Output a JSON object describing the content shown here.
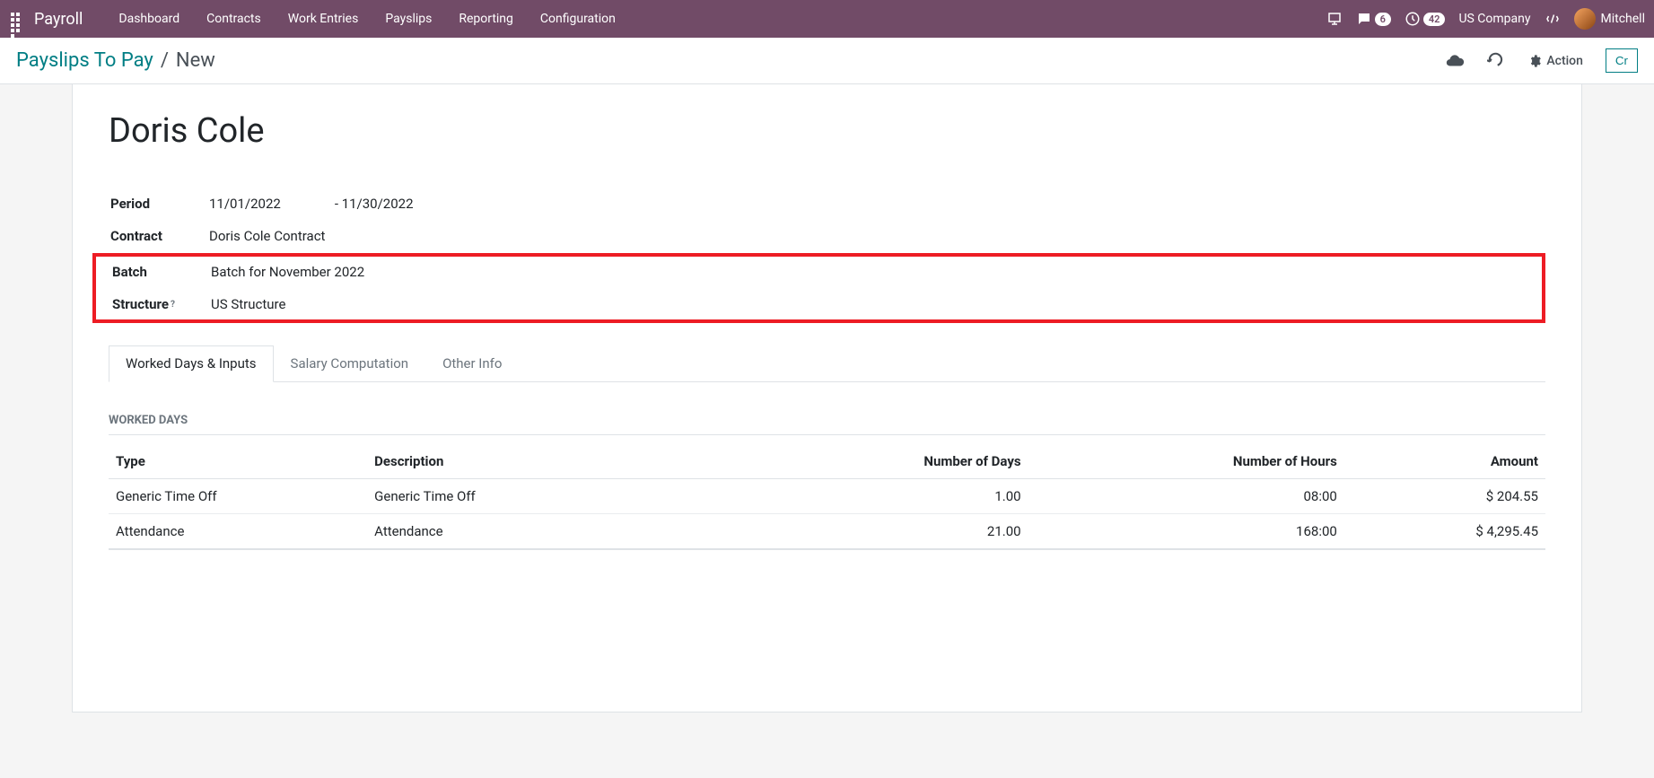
{
  "topbar": {
    "app_name": "Payroll",
    "nav": [
      "Dashboard",
      "Contracts",
      "Work Entries",
      "Payslips",
      "Reporting",
      "Configuration"
    ],
    "messages_count": "6",
    "activities_count": "42",
    "company": "US Company",
    "user": "Mitchell"
  },
  "breadcrumb": {
    "parent": "Payslips To Pay",
    "current": "New",
    "action_label": "Action",
    "create_label": "Cr"
  },
  "form": {
    "employee_name": "Doris Cole",
    "labels": {
      "period": "Period",
      "contract": "Contract",
      "batch": "Batch",
      "structure": "Structure"
    },
    "period_from": "11/01/2022",
    "period_to": "- 11/30/2022",
    "contract": "Doris Cole Contract",
    "batch": "Batch for November 2022",
    "structure": "US Structure"
  },
  "tabs": [
    "Worked Days & Inputs",
    "Salary Computation",
    "Other Info"
  ],
  "section_title": "Worked Days",
  "table": {
    "headers": {
      "type": "Type",
      "description": "Description",
      "days": "Number of Days",
      "hours": "Number of Hours",
      "amount": "Amount"
    },
    "rows": [
      {
        "type": "Generic Time Off",
        "description": "Generic Time Off",
        "days": "1.00",
        "hours": "08:00",
        "amount": "$ 204.55"
      },
      {
        "type": "Attendance",
        "description": "Attendance",
        "days": "21.00",
        "hours": "168:00",
        "amount": "$ 4,295.45"
      }
    ]
  }
}
